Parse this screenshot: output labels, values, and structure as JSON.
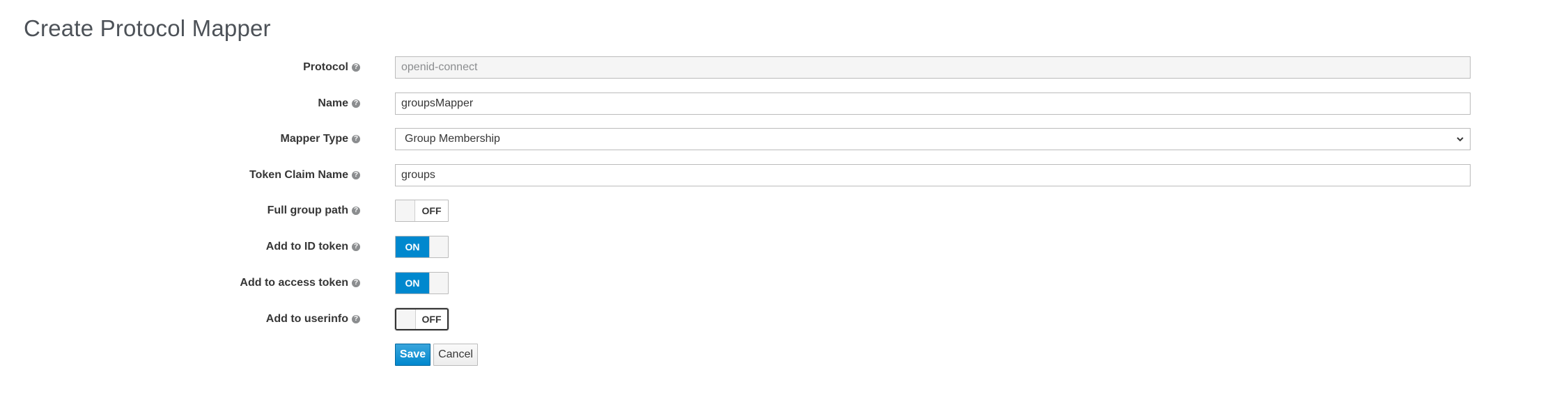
{
  "page": {
    "title": "Create Protocol Mapper"
  },
  "form": {
    "protocol": {
      "label": "Protocol",
      "value": "openid-connect"
    },
    "name": {
      "label": "Name",
      "value": "groupsMapper"
    },
    "mapper_type": {
      "label": "Mapper Type",
      "value": "Group Membership"
    },
    "token_claim_name": {
      "label": "Token Claim Name",
      "value": "groups"
    },
    "full_group_path": {
      "label": "Full group path",
      "state": "OFF"
    },
    "add_to_id_token": {
      "label": "Add to ID token",
      "state": "ON"
    },
    "add_to_access_token": {
      "label": "Add to access token",
      "state": "ON"
    },
    "add_to_userinfo": {
      "label": "Add to userinfo",
      "state": "OFF"
    },
    "help_glyph": "?"
  },
  "actions": {
    "save_label": "Save",
    "cancel_label": "Cancel"
  },
  "colors": {
    "accent": "#0088ce",
    "label_text": "#363636",
    "title_text": "#4d5258"
  },
  "icons": {
    "help": "question-circle-icon",
    "select_caret": "chevron-down-icon"
  }
}
